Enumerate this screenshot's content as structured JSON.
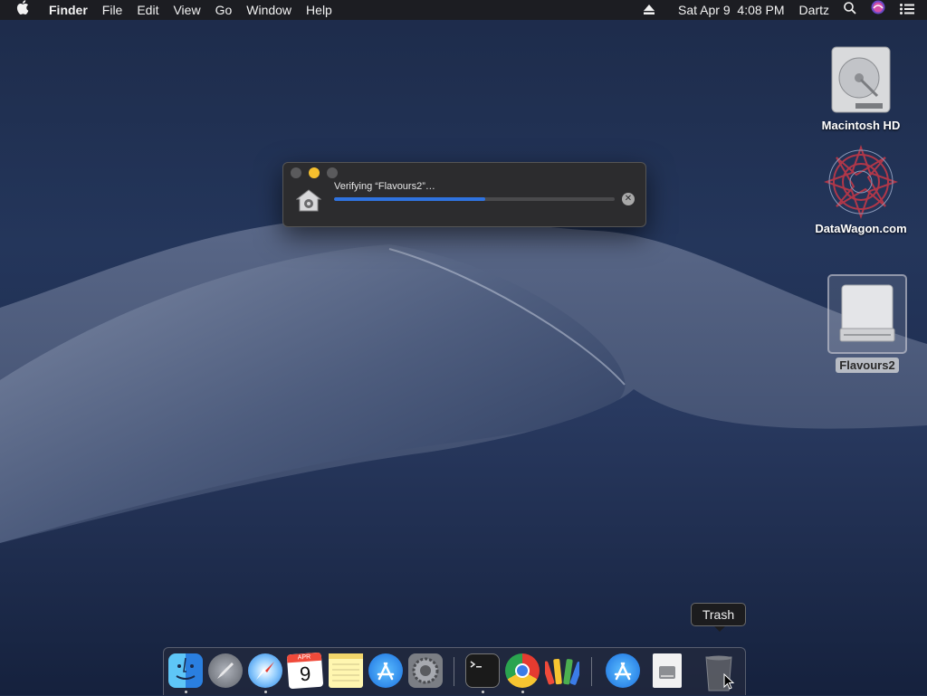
{
  "menubar": {
    "apple_icon": "apple-icon",
    "app_name": "Finder",
    "menus": [
      "File",
      "Edit",
      "View",
      "Go",
      "Window",
      "Help"
    ],
    "datetime": "Sat Apr 9  4:08 PM",
    "user": "Dartz",
    "status_icons": [
      "eject-icon",
      "search-icon",
      "siri-icon",
      "notification-center-icon"
    ]
  },
  "desktop": {
    "items": [
      {
        "label": "Macintosh HD",
        "icon": "hard-drive-icon"
      },
      {
        "label": "DataWagon.com",
        "icon": "datawagon-logo-icon"
      },
      {
        "label": "Flavours2",
        "icon": "external-drive-icon",
        "selected": true
      }
    ]
  },
  "progress_window": {
    "title": "Verifying “Flavours2”…",
    "progress": 0.54,
    "icon": "installer-gear-icon",
    "stop_icon": "stop-icon",
    "colors": {
      "accent": "#2f73e0",
      "close": "#5a5a5c",
      "minimize": "#f5bf2e",
      "zoom": "#5a5a5c"
    }
  },
  "tooltip": {
    "text": "Trash"
  },
  "dock": {
    "apps": [
      {
        "name": "Finder",
        "icon": "finder-icon",
        "running": true
      },
      {
        "name": "Launchpad",
        "icon": "launchpad-icon",
        "running": false
      },
      {
        "name": "Safari",
        "icon": "safari-icon",
        "running": true
      },
      {
        "name": "Calendar",
        "icon": "calendar-icon",
        "running": false,
        "month": "APR",
        "day": "9"
      },
      {
        "name": "Notes",
        "icon": "notes-icon",
        "running": false
      },
      {
        "name": "App Store",
        "icon": "app-store-icon",
        "running": false
      },
      {
        "name": "System Preferences",
        "icon": "system-preferences-icon",
        "running": false
      },
      {
        "name": "Terminal",
        "icon": "terminal-icon",
        "running": true
      },
      {
        "name": "Chrome",
        "icon": "chrome-icon",
        "running": true
      },
      {
        "name": "Flavours",
        "icon": "flavours-palette-icon",
        "running": false
      },
      {
        "name": "App Store Download",
        "icon": "app-store-download-icon",
        "running": false
      },
      {
        "name": "Disk Image",
        "icon": "disk-image-document-icon",
        "running": false
      },
      {
        "name": "Trash",
        "icon": "trash-icon",
        "running": false
      }
    ]
  }
}
